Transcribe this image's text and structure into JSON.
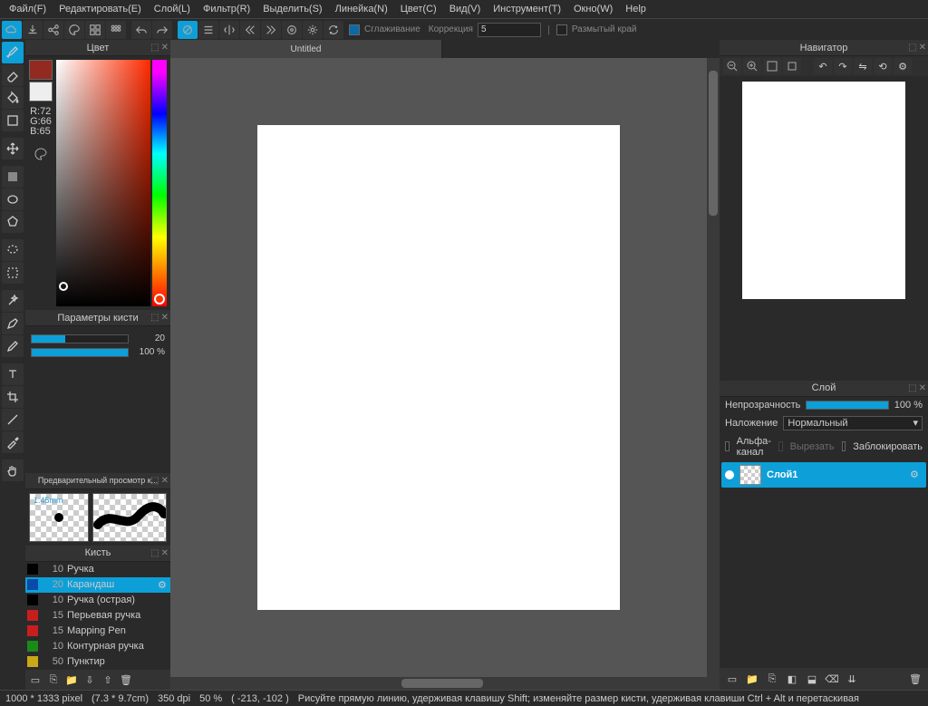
{
  "menu": [
    "Файл(F)",
    "Редактировать(E)",
    "Слой(L)",
    "Фильтр(R)",
    "Выделить(S)",
    "Линейка(N)",
    "Цвет(C)",
    "Вид(V)",
    "Инструмент(T)",
    "Окно(W)",
    "Help"
  ],
  "toolbar": {
    "smoothing": "Сглаживание",
    "correction": "Коррекция",
    "correction_val": "5",
    "blurry_edge": "Размытый край"
  },
  "panels": {
    "color": "Цвет",
    "brush_params": "Параметры кисти",
    "brush_preview": "Предварительный просмотр к...",
    "brush": "Кисть",
    "navigator": "Навигатор",
    "layer": "Слой"
  },
  "color": {
    "r": "R:72",
    "g": "G:66",
    "b": "B:65",
    "swatch1": "#932a20",
    "swatch2": "#eeeeee"
  },
  "brush_params": {
    "size_val": "20",
    "size_fill": 35,
    "opacity_val": "100 %",
    "opacity_fill": 100
  },
  "brush_preview": {
    "mm": "1.45mm"
  },
  "brushes": [
    {
      "c": "#000",
      "s": "10",
      "n": "Ручка"
    },
    {
      "c": "#0a4aa8",
      "s": "20",
      "n": "Карандаш",
      "sel": true
    },
    {
      "c": "#000",
      "s": "10",
      "n": "Ручка (острая)"
    },
    {
      "c": "#c81e1e",
      "s": "15",
      "n": "Перьевая ручка"
    },
    {
      "c": "#c81e1e",
      "s": "15",
      "n": "Mapping Pen"
    },
    {
      "c": "#1a8a1a",
      "s": "10",
      "n": "Контурная ручка"
    },
    {
      "c": "#c8a818",
      "s": "50",
      "n": "Пунктир"
    }
  ],
  "tab": "Untitled",
  "layer": {
    "opacity_label": "Непрозрачность",
    "opacity_val": "100 %",
    "blend_label": "Наложение",
    "blend_val": "Нормальный",
    "alpha": "Альфа-канал",
    "cut": "Вырезать",
    "lock": "Заблокировать",
    "name": "Слой1"
  },
  "status": {
    "size": "1000 * 1333 pixel",
    "cm": "(7.3 * 9.7cm)",
    "dpi": "350 dpi",
    "zoom": "50 %",
    "pos": "( -213, -102 )",
    "hint": "Рисуйте прямую линию, удерживая клавишу Shift; изменяйте размер кисти, удерживая клавиши Ctrl + Alt и перетаскивая"
  }
}
